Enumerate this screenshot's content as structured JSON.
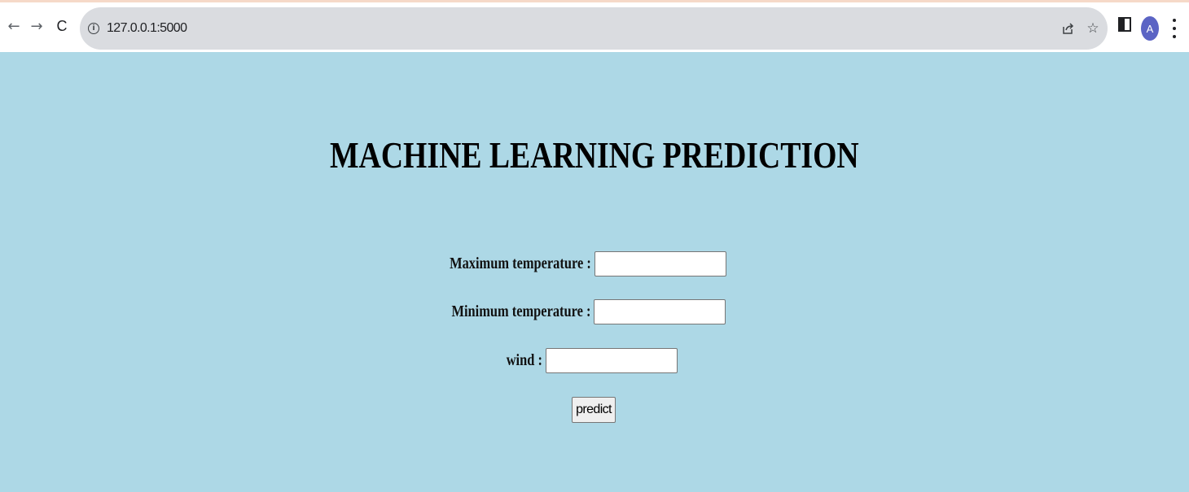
{
  "browser": {
    "url": "127.0.0.1:5000",
    "back_glyph": "←",
    "forward_glyph": "→",
    "reload_glyph": "C",
    "info_glyph": "i",
    "share_glyph": "⇪",
    "star_glyph": "☆",
    "avatar_letter": "A",
    "avatar_color": "#5b64c4"
  },
  "page": {
    "background": "#add8e6",
    "title": "MACHINE LEARNING PREDICTION",
    "fields": [
      {
        "label": "Maximum temperature :",
        "value": ""
      },
      {
        "label": "Minimum temperature :",
        "value": ""
      },
      {
        "label": "wind :",
        "value": ""
      }
    ],
    "submit_label": "predict"
  }
}
